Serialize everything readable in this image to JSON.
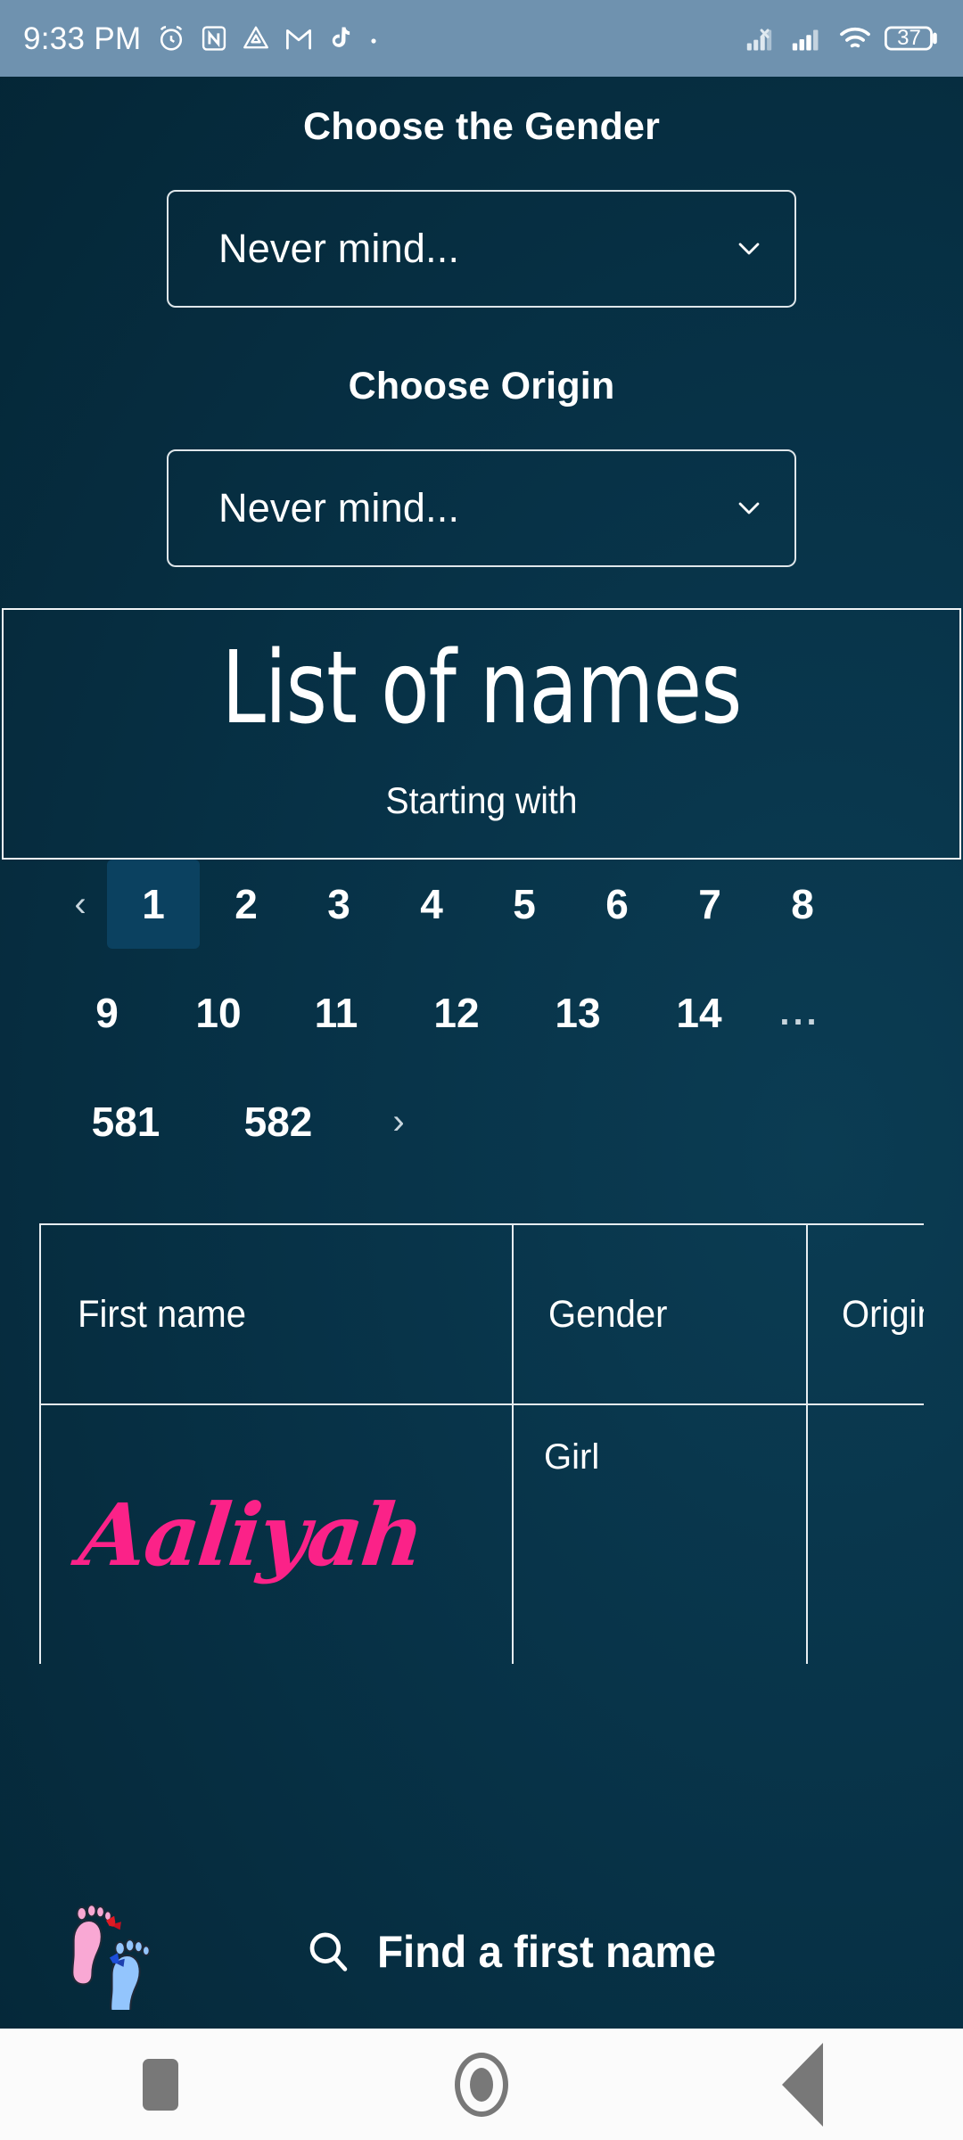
{
  "status_bar": {
    "time": "9:33 PM",
    "battery_percent": "37",
    "icons": [
      "alarm-icon",
      "nfc-icon",
      "drive-icon",
      "gmail-icon",
      "tiktok-icon",
      "dot-icon"
    ],
    "right_icons": [
      "signal-no-service-icon",
      "signal-bars-icon",
      "wifi-icon",
      "battery-icon"
    ],
    "background_color": "#6f92af"
  },
  "app": {
    "background_color": "#073247",
    "gender": {
      "label": "Choose the Gender",
      "selected": "Never mind..."
    },
    "origin": {
      "label": "Choose Origin",
      "selected": "Never mind..."
    },
    "list_panel": {
      "title": "List of names",
      "subtitle": "Starting with"
    },
    "pagination": {
      "prev": "‹",
      "next": "›",
      "ellipsis": "...",
      "active_page": "1",
      "row1": [
        "1",
        "2",
        "3",
        "4",
        "5",
        "6",
        "7",
        "8"
      ],
      "row2": [
        "9",
        "10",
        "11",
        "12",
        "13",
        "14"
      ],
      "row3": [
        "581",
        "582"
      ],
      "active_background": "#0b4160"
    },
    "table": {
      "headers": [
        "First name",
        "Gender",
        "Origin"
      ],
      "rows": [
        {
          "first_name": "Aaliyah",
          "gender": "Girl",
          "origin": ""
        }
      ],
      "name_color": "#fb2288"
    },
    "footer": {
      "logo": "baby-footprints-logo",
      "search_label": "Find a first name",
      "search_icon": "search-icon"
    }
  },
  "nav_bar": {
    "recents": "recents-button",
    "home": "home-button",
    "back": "back-button"
  }
}
